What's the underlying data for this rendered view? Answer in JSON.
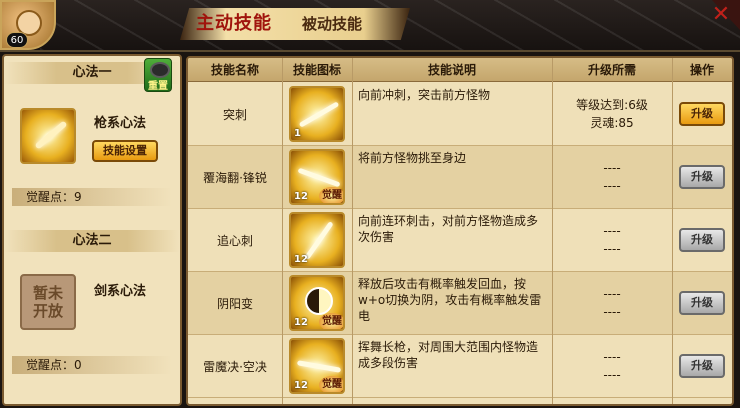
{
  "header": {
    "level": "60",
    "tab_active": "主动技能",
    "tab_passive": "被动技能",
    "close_glyph": "✕"
  },
  "left_panel": {
    "method1": {
      "title": "心法一",
      "reset_label": "重置",
      "name": "枪系心法",
      "change_label": "技能设置",
      "points": "觉醒点：9"
    },
    "method2": {
      "title": "心法二",
      "locked_label": "暂未开放",
      "name": "剑系心法",
      "points": "觉醒点：0"
    }
  },
  "table": {
    "headers": {
      "name": "技能名称",
      "icon": "技能图标",
      "desc": "技能说明",
      "req": "升级所需",
      "op": "操作"
    },
    "rows": [
      {
        "name": "突刺",
        "level": "1",
        "awaken": "",
        "desc": "向前冲刺，突击前方怪物",
        "req1": "等级达到:6级",
        "req2": "灵魂:85",
        "button": "升级",
        "active": true
      },
      {
        "name": "覆海翻·锋锐",
        "level": "12",
        "awaken": "觉醒",
        "desc": "将前方怪物挑至身边",
        "req1": "----",
        "req2": "----",
        "button": "升级",
        "active": false
      },
      {
        "name": "追心刺",
        "level": "12",
        "awaken": "",
        "desc": "向前连环刺击，对前方怪物造成多次伤害",
        "req1": "----",
        "req2": "----",
        "button": "升级",
        "active": false
      },
      {
        "name": "阴阳变",
        "level": "12",
        "awaken": "觉醒",
        "desc": "释放后攻击有概率触发回血，按w+o切换为阴，攻击有概率触发雷电",
        "req1": "----",
        "req2": "----",
        "button": "升级",
        "active": false
      },
      {
        "name": "雷魔决·空决",
        "level": "12",
        "awaken": "觉醒",
        "desc": "挥舞长枪，对周围大范围内怪物造成多段伤害",
        "req1": "----",
        "req2": "----",
        "button": "升级",
        "active": false
      }
    ]
  }
}
